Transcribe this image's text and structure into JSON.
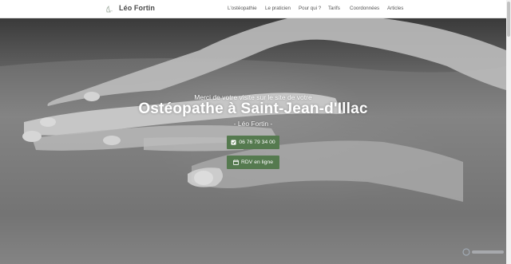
{
  "header": {
    "brand": "Léo Fortin",
    "nav": [
      {
        "label": "L'ostéopathie"
      },
      {
        "label": "Le praticien"
      },
      {
        "label": "Pour qui ?"
      },
      {
        "label": "Tarifs"
      },
      {
        "label": "Coordonnées"
      },
      {
        "label": "Articles"
      }
    ]
  },
  "hero": {
    "subtitle": "Merci de votre visite sur le site de votre",
    "title": "Ostéopathe à Saint-Jean-d'Illac",
    "name": "- Léo Fortin -",
    "phone_label": "06 76 79 34 00",
    "rdv_label": "RDV en ligne"
  },
  "colors": {
    "button": "#557a4f",
    "nav_text": "#555555"
  }
}
